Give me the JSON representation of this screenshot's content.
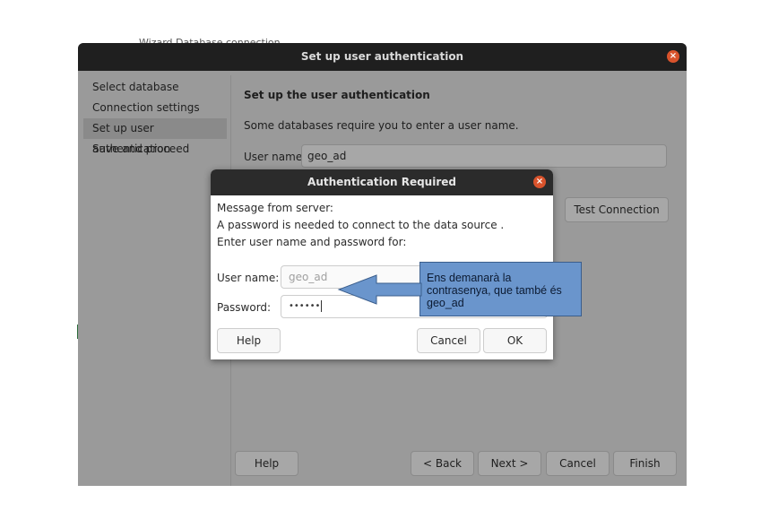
{
  "background_fragment": {
    "text": "Wizard Database connection"
  },
  "wizard": {
    "title": "Set up user authentication",
    "close_glyph": "×",
    "steps": [
      {
        "label": "Select database",
        "active": false
      },
      {
        "label": "Connection settings",
        "active": false
      },
      {
        "label": "Set up user authentication",
        "active": true
      },
      {
        "label": "Save and proceed",
        "active": false
      }
    ],
    "panel": {
      "heading": "Set up the user authentication",
      "description": "Some databases require you to enter a user name.",
      "user_label": "User name",
      "user_value": "geo_ad",
      "test_connection_label": "Test Connection"
    },
    "footer": {
      "help_label": "Help",
      "back_label": "< Back",
      "next_label": "Next >",
      "cancel_label": "Cancel",
      "finish_label": "Finish"
    }
  },
  "auth_dialog": {
    "title": "Authentication Required",
    "close_glyph": "×",
    "message_lines": [
      "Message from server:",
      "A password is needed to connect to the data source .",
      "Enter user name and password for:"
    ],
    "username_label": "User name:",
    "username_value": "geo_ad",
    "password_label": "Password:",
    "password_mask": "••••••",
    "help_label": "Help",
    "cancel_label": "Cancel",
    "ok_label": "OK"
  },
  "annotation": {
    "text": "Ens demanarà la contrasenya, que també és geo_ad",
    "fill_color": "#6a95cc",
    "arrow_target": "username-field"
  },
  "colors": {
    "titlebar": "#1f1f1f",
    "close_button": "#d9532c",
    "dimmed_window": "#9a9a9a"
  }
}
